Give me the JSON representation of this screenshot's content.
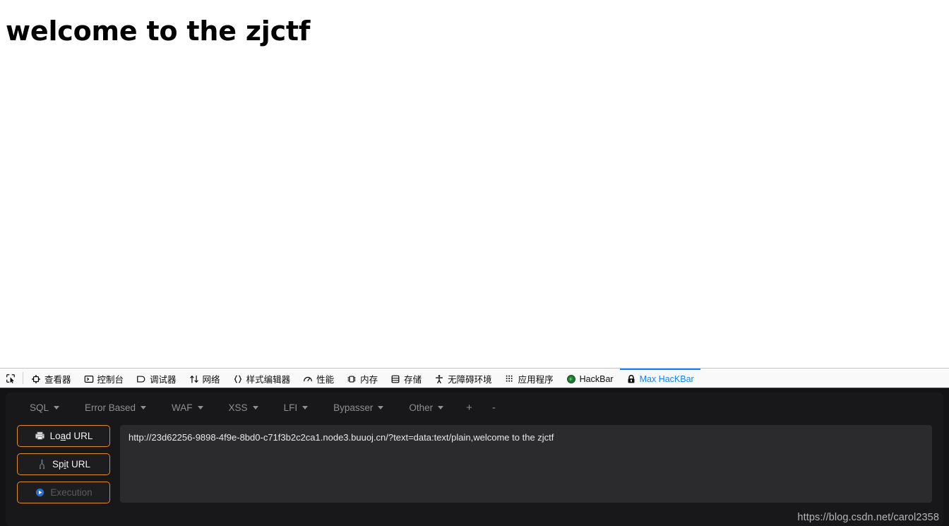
{
  "page": {
    "heading": "welcome to the zjctf"
  },
  "devtools": {
    "picker_icon": "element-picker-icon",
    "tabs": [
      {
        "label": "查看器",
        "icon": "inspector-icon",
        "active": false
      },
      {
        "label": "控制台",
        "icon": "console-icon",
        "active": false
      },
      {
        "label": "调试器",
        "icon": "debugger-icon",
        "active": false
      },
      {
        "label": "网络",
        "icon": "network-icon",
        "active": false
      },
      {
        "label": "样式编辑器",
        "icon": "style-editor-icon",
        "active": false
      },
      {
        "label": "性能",
        "icon": "performance-icon",
        "active": false
      },
      {
        "label": "内存",
        "icon": "memory-icon",
        "active": false
      },
      {
        "label": "存储",
        "icon": "storage-icon",
        "active": false
      },
      {
        "label": "无障碍环境",
        "icon": "accessibility-icon",
        "active": false
      },
      {
        "label": "应用程序",
        "icon": "application-icon",
        "active": false
      },
      {
        "label": "HackBar",
        "icon": "hackbar-icon",
        "active": false
      },
      {
        "label": "Max HacKBar",
        "icon": "lock-icon",
        "active": true
      }
    ],
    "active_tab_color": "#0a84ff",
    "toolbar_bg": "#f9f9fa"
  },
  "hackbar": {
    "menu": [
      {
        "label": "SQL",
        "has_caret": true
      },
      {
        "label": "Error Based",
        "has_caret": true
      },
      {
        "label": "WAF",
        "has_caret": true
      },
      {
        "label": "XSS",
        "has_caret": true
      },
      {
        "label": "LFI",
        "has_caret": true
      },
      {
        "label": "Bypasser",
        "has_caret": true
      },
      {
        "label": "Other",
        "has_caret": true
      }
    ],
    "add_label": "+",
    "remove_label": "-",
    "buttons": [
      {
        "label": "Load URL",
        "icon": "load-url-icon",
        "accesskey": "a",
        "disabled": false
      },
      {
        "label": "Spit URL",
        "icon": "split-url-icon",
        "accesskey": "i",
        "disabled": false
      },
      {
        "label": "Execution",
        "icon": "execute-icon",
        "accesskey": "",
        "disabled": true
      }
    ],
    "url_value": "http://23d62256-9898-4f9e-8bd0-c71f3b2c2ca1.node3.buuoj.cn/?text=data:text/plain,welcome to the zjctf",
    "url_placeholder": "",
    "accent_color": "#e08b2a",
    "panel_bg": "#18181a",
    "input_bg": "#2b2b2e"
  },
  "watermark": {
    "text": "https://blog.csdn.net/carol2358"
  }
}
